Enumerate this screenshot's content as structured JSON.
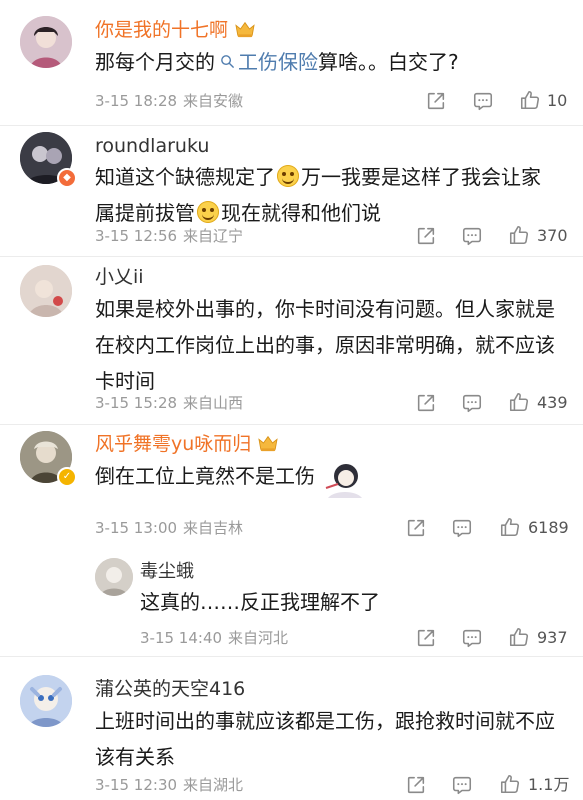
{
  "comments": [
    {
      "username": "你是我的十七啊",
      "vip": true,
      "content_prefix": "那每个月交的",
      "topic_link": "工伤保险",
      "content_suffix": "算啥。。白交了?",
      "date": "3-15 18:28",
      "location": "来自安徽",
      "likes": "10",
      "avatar_color": "#d9c4cd"
    },
    {
      "username": "roundlaruku",
      "vip": false,
      "line1_a": "知道这个缺德规定了",
      "line1_b": "万一我要是这样了我会让家",
      "line2_a": "属提前拔管",
      "line2_b": "现在就得和他们说",
      "date": "3-15 12:56",
      "location": "来自辽宁",
      "likes": "370",
      "avatar_color": "#3d3f48",
      "badge_color": "#f36c3a"
    },
    {
      "username": "小乂ii",
      "vip": false,
      "lines": [
        "如果是校外出事的，你卡时间没有问题。但人家就是",
        "在校内工作岗位上出的事，原因非常明确，就不应该",
        "卡时间"
      ],
      "date": "3-15 15:28",
      "location": "来自山西",
      "likes": "439",
      "avatar_color": "#d7c9c2"
    },
    {
      "username": "风乎舞雩yu咏而归",
      "vip": true,
      "lines": [
        "倒在工位上竟然不是工伤"
      ],
      "date": "3-15 13:00",
      "location": "来自吉林",
      "likes": "6189",
      "avatar_color": "#8e8a7a",
      "badge_color": "#f5b400"
    },
    {
      "username": "毒尘蛾",
      "vip": false,
      "lines": [
        "这真的……反正我理解不了"
      ],
      "date": "3-15 14:40",
      "location": "来自河北",
      "likes": "937",
      "avatar_color": "#cfcac4"
    },
    {
      "username": "蒲公英的天空416",
      "vip": false,
      "lines": [
        "上班时间出的事就应该都是工伤，跟抢救时间就不应",
        "该有关系"
      ],
      "date": "3-15 12:30",
      "location": "来自湖北",
      "likes": "1.1万",
      "avatar_color": "#b7c9e6"
    }
  ],
  "icons": {
    "share": "share-icon",
    "comment": "comment-icon",
    "like": "like-icon",
    "search": "search-icon",
    "crown": "vip-crown-icon"
  },
  "colors": {
    "vip_name": "#f07327",
    "link": "#4f7cae",
    "meta": "#9a9a9a"
  }
}
